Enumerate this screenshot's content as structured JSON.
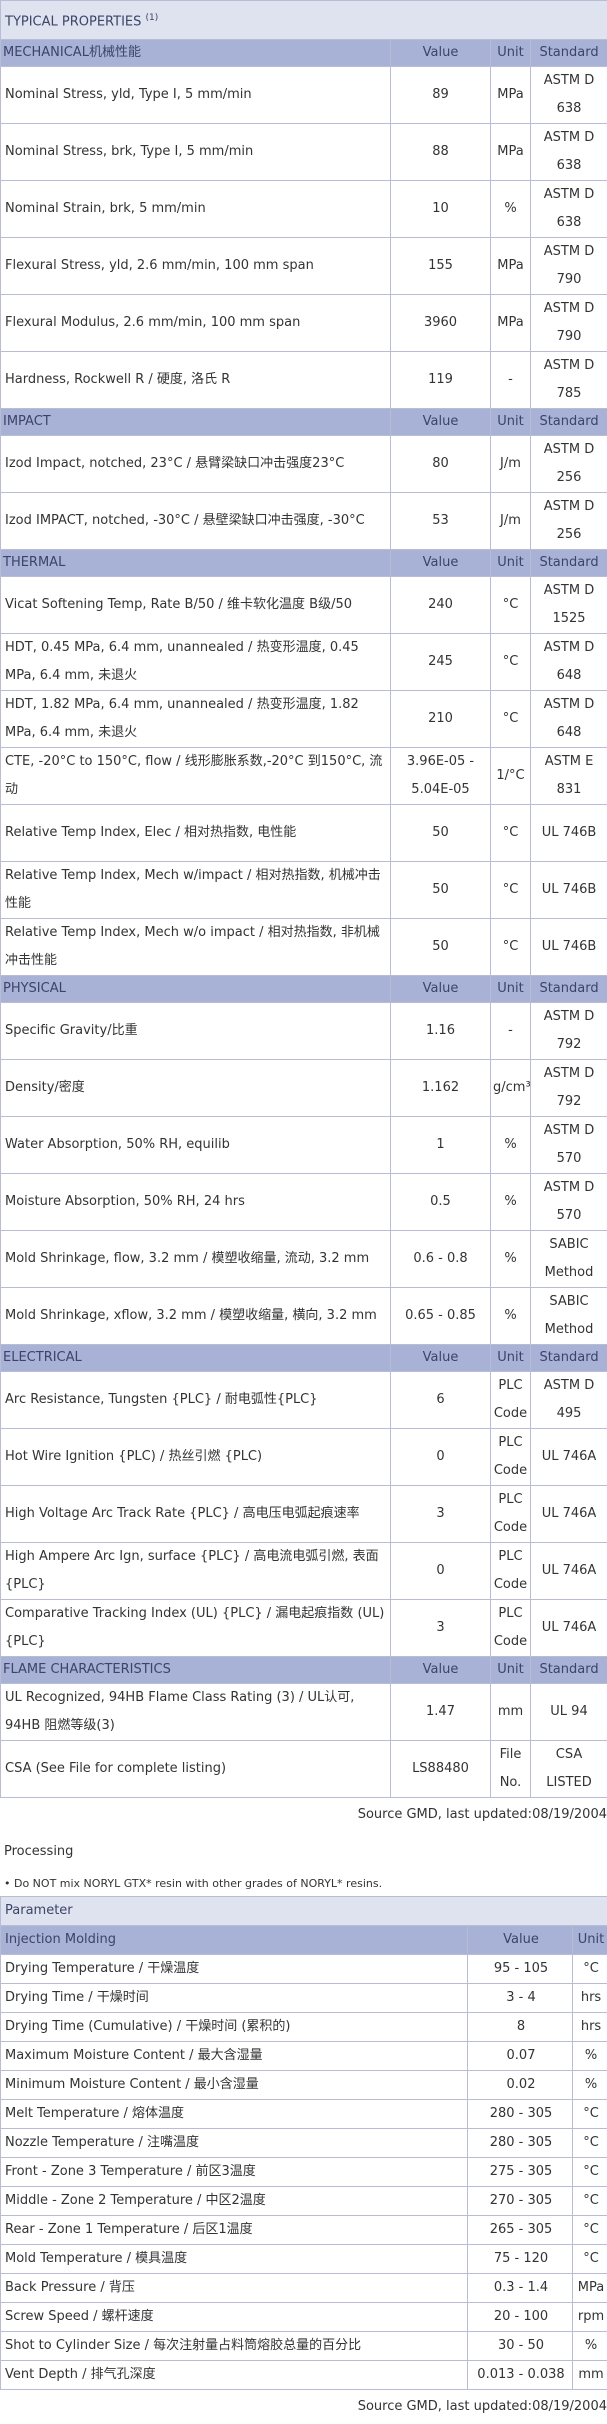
{
  "typical_properties": {
    "title": "TYPICAL PROPERTIES",
    "title_sup": "(1)",
    "sections": [
      {
        "name": "MECHANICAL机械性能",
        "value_h": "Value",
        "unit_h": "Unit",
        "std_h": "Standard",
        "rows": [
          {
            "prop": "Nominal Stress, yld, Type I, 5 mm/min",
            "value": "89",
            "unit": "MPa",
            "std": "ASTM D 638"
          },
          {
            "prop": "Nominal Stress, brk, Type I, 5 mm/min",
            "value": "88",
            "unit": "MPa",
            "std": "ASTM D 638"
          },
          {
            "prop": "Nominal Strain, brk, 5 mm/min",
            "value": "10",
            "unit": "%",
            "std": "ASTM D 638"
          },
          {
            "prop": "Flexural Stress, yld, 2.6 mm/min, 100 mm span",
            "value": "155",
            "unit": "MPa",
            "std": "ASTM D 790"
          },
          {
            "prop": "Flexural Modulus, 2.6 mm/min, 100 mm span",
            "value": "3960",
            "unit": "MPa",
            "std": "ASTM D 790"
          },
          {
            "prop": "Hardness, Rockwell R / 硬度, 洛氏 R",
            "value": "119",
            "unit": "-",
            "std": "ASTM D 785"
          }
        ]
      },
      {
        "name": "IMPACT",
        "value_h": "Value",
        "unit_h": "Unit",
        "std_h": "Standard",
        "rows": [
          {
            "prop": "Izod Impact, notched, 23°C / 悬臂梁缺口冲击强度23°C",
            "value": "80",
            "unit": "J/m",
            "std": "ASTM D 256"
          },
          {
            "prop": "Izod IMPACT, notched, -30°C / 悬壁梁缺口冲击强度, -30°C",
            "value": "53",
            "unit": "J/m",
            "std": "ASTM D 256"
          }
        ]
      },
      {
        "name": "THERMAL",
        "value_h": "Value",
        "unit_h": "Unit",
        "std_h": "Standard",
        "rows": [
          {
            "prop": "Vicat Softening Temp, Rate B/50 / 维卡软化温度 B级/50",
            "value": "240",
            "unit": "°C",
            "std": "ASTM D 1525"
          },
          {
            "prop": "HDT, 0.45 MPa, 6.4 mm, unannealed / 热变形温度, 0.45 MPa, 6.4 mm, 未退火",
            "value": "245",
            "unit": "°C",
            "std": "ASTM D 648"
          },
          {
            "prop": "HDT, 1.82 MPa, 6.4 mm, unannealed / 热变形温度, 1.82 MPa, 6.4 mm, 未退火",
            "value": "210",
            "unit": "°C",
            "std": "ASTM D 648"
          },
          {
            "prop": "CTE, -20°C to 150°C, flow / 线形膨胀系数,-20°C 到150°C, 流动",
            "value": "3.96E-05 - 5.04E-05",
            "unit": "1/°C",
            "std": "ASTM E 831"
          },
          {
            "prop": "Relative Temp Index, Elec / 相对热指数, 电性能",
            "value": "50",
            "unit": "°C",
            "std": "UL 746B"
          },
          {
            "prop": "Relative Temp Index, Mech w/impact / 相对热指数, 机械冲击性能",
            "value": "50",
            "unit": "°C",
            "std": "UL 746B"
          },
          {
            "prop": "Relative Temp Index, Mech w/o impact / 相对热指数, 非机械冲击性能",
            "value": "50",
            "unit": "°C",
            "std": "UL 746B"
          }
        ]
      },
      {
        "name": "PHYSICAL",
        "value_h": "Value",
        "unit_h": "Unit",
        "std_h": "Standard",
        "rows": [
          {
            "prop": "Specific Gravity/比重",
            "value": "1.16",
            "unit": "-",
            "std": "ASTM D 792"
          },
          {
            "prop": "Density/密度",
            "value": "1.162",
            "unit": "g/cm³",
            "std": "ASTM D 792"
          },
          {
            "prop": "Water Absorption, 50% RH, equilib",
            "value": "1",
            "unit": "%",
            "std": "ASTM D 570"
          },
          {
            "prop": "Moisture Absorption, 50% RH, 24 hrs",
            "value": "0.5",
            "unit": "%",
            "std": "ASTM D 570"
          },
          {
            "prop": "Mold Shrinkage, flow, 3.2 mm / 模塑收缩量, 流动, 3.2 mm",
            "value": "0.6 - 0.8",
            "unit": "%",
            "std": "SABIC Method"
          },
          {
            "prop": "Mold Shrinkage, xflow, 3.2 mm / 模塑收缩量, 横向, 3.2 mm",
            "value": "0.65 - 0.85",
            "unit": "%",
            "std": "SABIC Method"
          }
        ]
      },
      {
        "name": "ELECTRICAL",
        "value_h": "Value",
        "unit_h": "Unit",
        "std_h": "Standard",
        "rows": [
          {
            "prop": "Arc Resistance, Tungsten {PLC} / 耐电弧性{PLC}",
            "value": "6",
            "unit": "PLC Code",
            "std": "ASTM D 495"
          },
          {
            "prop": "Hot Wire Ignition {PLC) / 热丝引燃 {PLC)",
            "value": "0",
            "unit": "PLC Code",
            "std": "UL 746A"
          },
          {
            "prop": "High Voltage Arc Track Rate {PLC} / 高电压电弧起痕速率",
            "value": "3",
            "unit": "PLC Code",
            "std": "UL 746A"
          },
          {
            "prop": "High Ampere Arc Ign, surface {PLC} / 高电流电弧引燃, 表面{PLC}",
            "value": "0",
            "unit": "PLC Code",
            "std": "UL 746A"
          },
          {
            "prop": "Comparative Tracking Index (UL) {PLC} / 漏电起痕指数 (UL) {PLC}",
            "value": "3",
            "unit": "PLC Code",
            "std": "UL 746A"
          }
        ]
      },
      {
        "name": "FLAME CHARACTERISTICS",
        "value_h": "Value",
        "unit_h": "Unit",
        "std_h": "Standard",
        "rows": [
          {
            "prop": "UL Recognized, 94HB Flame Class Rating (3) / UL认可, 94HB 阻燃等级(3)",
            "value": "1.47",
            "unit": "mm",
            "std": "UL 94"
          },
          {
            "prop": "CSA (See File for complete listing)",
            "value": "LS88480",
            "unit": "File No.",
            "std": "CSA LISTED"
          }
        ]
      }
    ],
    "source": "Source GMD, last updated:08/19/2004"
  },
  "processing": {
    "heading": "Processing",
    "note": "• Do NOT mix NORYL GTX* resin with other grades of NORYL* resins.",
    "param_label": "Parameter",
    "section": "Injection Molding",
    "value_h": "Value",
    "unit_h": "Unit",
    "rows": [
      {
        "prop": "Drying Temperature / 干燥温度",
        "value": "95 - 105",
        "unit": "°C"
      },
      {
        "prop": "Drying Time / 干燥时间",
        "value": "3 - 4",
        "unit": "hrs"
      },
      {
        "prop": "Drying Time (Cumulative) / 干燥时间 (累积的)",
        "value": "8",
        "unit": "hrs"
      },
      {
        "prop": "Maximum Moisture Content / 最大含湿量",
        "value": "0.07",
        "unit": "%"
      },
      {
        "prop": "Minimum Moisture Content / 最小含湿量",
        "value": "0.02",
        "unit": "%"
      },
      {
        "prop": "Melt Temperature / 熔体温度",
        "value": "280 - 305",
        "unit": "°C"
      },
      {
        "prop": "Nozzle Temperature / 注嘴温度",
        "value": "280 - 305",
        "unit": "°C"
      },
      {
        "prop": "Front - Zone 3 Temperature / 前区3温度",
        "value": "275 - 305",
        "unit": "°C"
      },
      {
        "prop": "Middle - Zone 2 Temperature / 中区2温度",
        "value": "270 - 305",
        "unit": "°C"
      },
      {
        "prop": "Rear - Zone 1 Temperature / 后区1温度",
        "value": "265 - 305",
        "unit": "°C"
      },
      {
        "prop": "Mold Temperature / 模具温度",
        "value": "75 - 120",
        "unit": "°C"
      },
      {
        "prop": "Back Pressure / 背压",
        "value": "0.3 - 1.4",
        "unit": "MPa"
      },
      {
        "prop": "Screw Speed / 螺杆速度",
        "value": "20 - 100",
        "unit": "rpm"
      },
      {
        "prop": "Shot to Cylinder Size / 每次注射量占料筒熔胶总量的百分比",
        "value": "30 - 50",
        "unit": "%"
      },
      {
        "prop": "Vent Depth / 排气孔深度",
        "value": "0.013 - 0.038",
        "unit": "mm"
      }
    ],
    "source": "Source GMD, last updated:08/19/2004"
  }
}
